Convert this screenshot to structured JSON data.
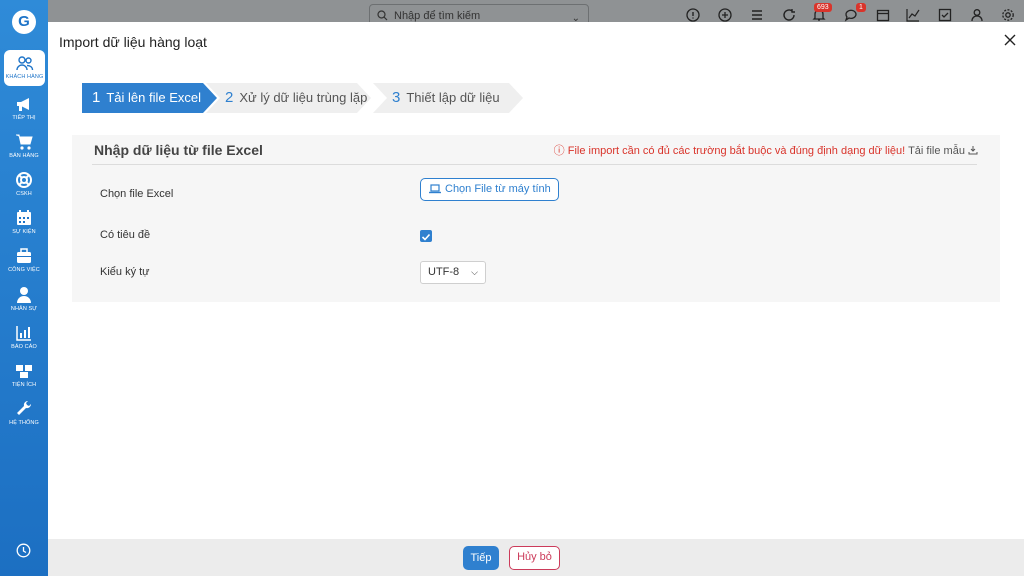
{
  "sidebar": {
    "logo": "G",
    "items": [
      {
        "label": "KHÁCH HÀNG",
        "icon": "users-icon"
      },
      {
        "label": "TIẾP THỊ",
        "icon": "megaphone-icon"
      },
      {
        "label": "BÁN HÀNG",
        "icon": "cart-icon"
      },
      {
        "label": "CSKH",
        "icon": "lifebuoy-icon"
      },
      {
        "label": "SỰ KIỆN",
        "icon": "calendar-icon"
      },
      {
        "label": "CÔNG VIỆC",
        "icon": "briefcase-icon"
      },
      {
        "label": "NHÂN SỰ",
        "icon": "person-icon"
      },
      {
        "label": "BÁO CÁO",
        "icon": "chart-icon"
      },
      {
        "label": "TIỆN ÍCH",
        "icon": "boxes-icon"
      },
      {
        "label": "HỆ THỐNG",
        "icon": "wrench-icon"
      }
    ],
    "active_index": 0
  },
  "topbar": {
    "search_placeholder": "Nhập để tìm kiếm",
    "notification_badge": "693",
    "message_badge": "1"
  },
  "modal": {
    "title": "Import dữ liệu hàng loạt",
    "steps": [
      {
        "num": "1",
        "label": "Tải lên file Excel",
        "active": true
      },
      {
        "num": "2",
        "label": "Xử lý dữ liệu trùng lặp",
        "active": false
      },
      {
        "num": "3",
        "label": "Thiết lập dữ liệu",
        "active": false
      }
    ],
    "panel": {
      "title": "Nhập dữ liệu từ file Excel",
      "warning": "File import cần có đủ các trường bắt buộc và đúng định dạng dữ liệu!",
      "download_label": "Tải file mẫu",
      "choose_file_label": "Chọn file Excel",
      "choose_file_button": "Chọn File từ máy tính",
      "has_header_label": "Có tiêu đề",
      "has_header_checked": true,
      "encoding_label": "Kiểu ký tự",
      "encoding_value": "UTF-8"
    },
    "footer": {
      "next_label": "Tiếp",
      "cancel_label": "Hủy bỏ"
    }
  },
  "colors": {
    "primary": "#2f80cf",
    "danger": "#d9342b",
    "cancel": "#cc3b5a",
    "sidebar": "#1e74c8"
  }
}
